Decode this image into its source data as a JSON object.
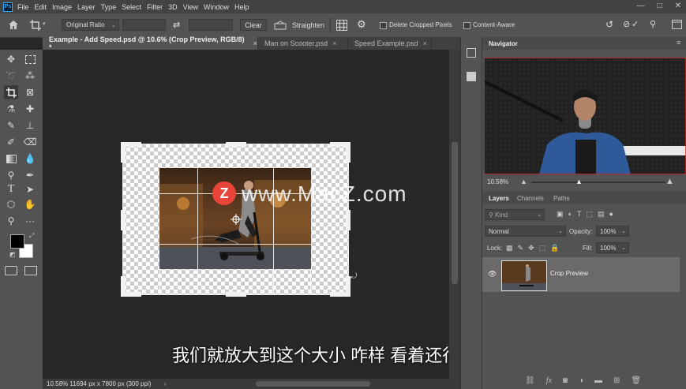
{
  "menubar": {
    "logo": "Ps",
    "items": [
      "File",
      "Edit",
      "Image",
      "Layer",
      "Type",
      "Select",
      "Filter",
      "3D",
      "View",
      "Window",
      "Help"
    ],
    "controls": [
      "—",
      "□",
      "✕"
    ]
  },
  "options": {
    "ratio": "Original Ratio",
    "clear": "Clear",
    "straighten": "Straighten",
    "delete_cropped": "Delete Cropped Pixels",
    "content_aware": "Content-Aware"
  },
  "tabs": [
    {
      "label": "Example - Add Speed.psd @ 10.6% (Crop Preview, RGB/8) *",
      "close": "×"
    },
    {
      "label": "Man on Scooter.psd",
      "close": "×"
    },
    {
      "label": "Speed Example.psd",
      "close": "×"
    }
  ],
  "status": {
    "text": "10.58%  11694 px x 7800 px (300 ppi)",
    "arrow": "›"
  },
  "watermark": {
    "letter": "Z",
    "text": "www.MacZ.com"
  },
  "subtitle": "我们就放大到这个大小 咋样 看着还行",
  "navigator": {
    "title": "Navigator",
    "zoom": "10.58%"
  },
  "layers_panel": {
    "tabs": [
      "Layers",
      "Channels",
      "Paths"
    ],
    "kind": "Kind",
    "blend": "Normal",
    "opacity_label": "Opacity:",
    "opacity": "100%",
    "lock_label": "Lock:",
    "fill_label": "Fill:",
    "fill": "100%",
    "layer_name": "Crop Preview"
  }
}
